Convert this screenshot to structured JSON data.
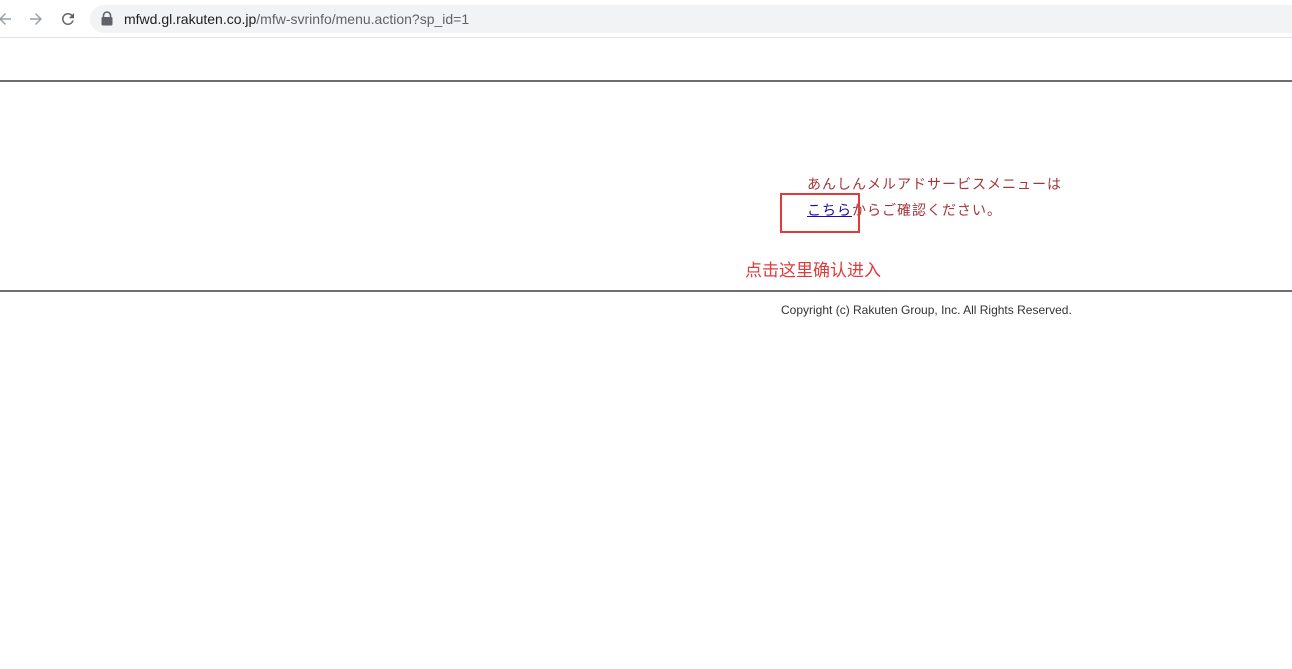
{
  "browser": {
    "url_host": "mfwd.gl.rakuten.co.jp",
    "url_path": "/mfw-svrinfo/menu.action?sp_id=1",
    "icons": {
      "back": "arrow-left-icon",
      "forward": "arrow-right-icon",
      "reload": "reload-icon",
      "secure": "lock-icon"
    }
  },
  "content": {
    "message_line1": "あんしんメルアドサービスメニューは",
    "link_label": "こちら",
    "message_line2_suffix": "からご確認ください。",
    "annotation": "点击这里确认进入",
    "copyright": "Copyright (c) Rakuten Group, Inc. All Rights Reserved."
  },
  "colors": {
    "message_text": "#a4373a",
    "link": "#1a0dab",
    "annotation": "#e03a3a",
    "rule": "#6e6e6e"
  }
}
